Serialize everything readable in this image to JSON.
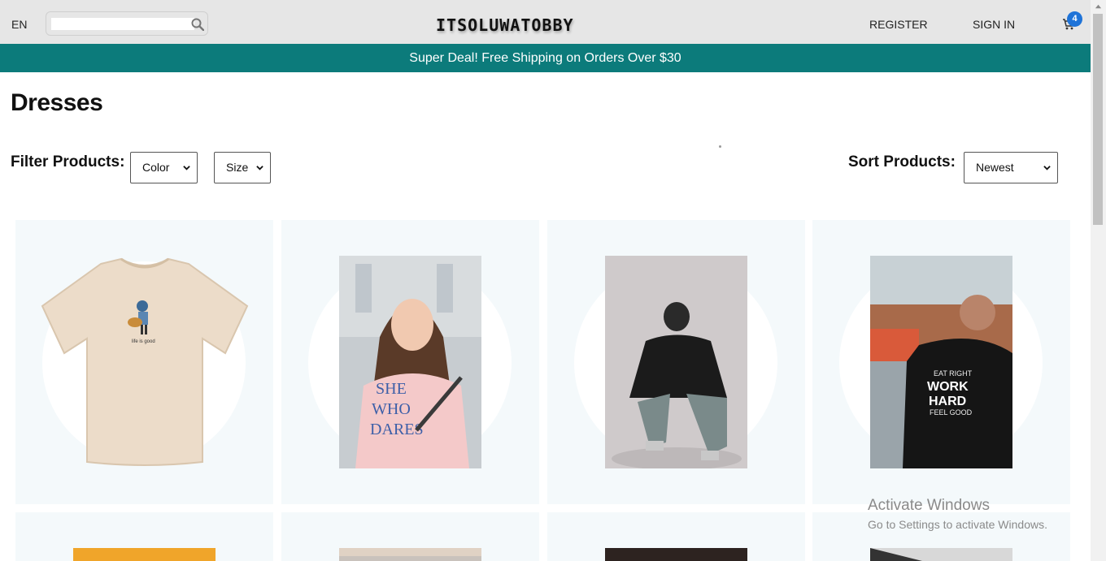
{
  "navbar": {
    "language": "EN",
    "search_placeholder": "",
    "brand": "ITSOLUWATOBBY",
    "register_label": "REGISTER",
    "signin_label": "SIGN IN",
    "cart_count": "4",
    "cart_icon": "shopping-cart-icon",
    "search_icon": "search-icon"
  },
  "announcement": {
    "text": "Super Deal! Free Shipping on Orders Over $30"
  },
  "page": {
    "title": "Dresses"
  },
  "filters": {
    "label": "Filter Products:",
    "color_select": "Color",
    "size_select": "Size"
  },
  "sort": {
    "label": "Sort Products:",
    "selected": "Newest"
  },
  "products": [
    {
      "image": "cream t-shirt with guitar player graphic"
    },
    {
      "image": "woman in pink printed t-shirt"
    },
    {
      "image": "man in black oversized t-shirt crouching"
    },
    {
      "image": "man in black WORK HARD t-shirt"
    },
    {
      "image": "orange product photo"
    },
    {
      "image": "product photo"
    },
    {
      "image": "dark product photo"
    },
    {
      "image": "product photo"
    }
  ],
  "tshirt_print": "EAT RIGHT WORK HARD FEEL GOOD",
  "watermark": {
    "title": "Activate Windows",
    "subtitle": "Go to Settings to activate Windows."
  },
  "colors": {
    "navbar_bg": "#e6e6e6",
    "announcement_bg": "#0c7b7b",
    "card_bg": "#f4f9fb",
    "badge": "#1e73d8"
  }
}
